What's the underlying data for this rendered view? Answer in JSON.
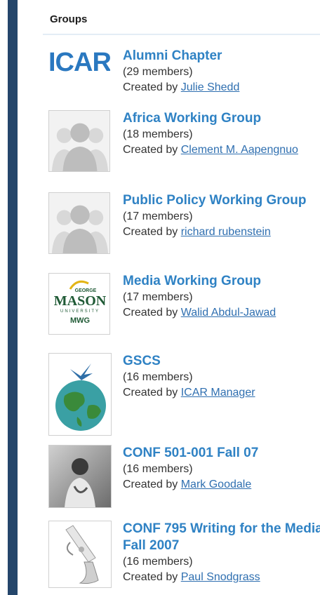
{
  "panel": {
    "title": "Groups"
  },
  "groups": [
    {
      "name": "Alumni Chapter",
      "members": "(29 members)",
      "created_prefix": "Created by ",
      "creator": "Julie Shedd",
      "thumb": "icar-logo"
    },
    {
      "name": "Africa Working Group",
      "members": "(18 members)",
      "created_prefix": "Created by ",
      "creator": "Clement M. Aapengnuo",
      "thumb": "default-people"
    },
    {
      "name": "Public Policy Working Group",
      "members": "(17 members)",
      "created_prefix": "Created by ",
      "creator": "richard rubenstein",
      "thumb": "default-people"
    },
    {
      "name": "Media Working Group",
      "members": "(17 members)",
      "created_prefix": "Created by ",
      "creator": "Walid Abdul-Jawad",
      "thumb": "mason-logo"
    },
    {
      "name": "GSCS",
      "members": "(16 members)",
      "created_prefix": "Created by ",
      "creator": "ICAR Manager",
      "thumb": "globe-image"
    },
    {
      "name": "CONF 501-001 Fall 07",
      "members": "(16 members)",
      "created_prefix": "Created by ",
      "creator": "Mark Goodale",
      "thumb": "photo-gandhi"
    },
    {
      "name": "CONF 795 Writing for the Media Fall 2007",
      "members": "(16 members)",
      "created_prefix": "Created by ",
      "creator": "Paul Snodgrass",
      "thumb": "award-image"
    }
  ],
  "logos": {
    "icar_text": "ICAR",
    "mason_top": "GEORGE",
    "mason_main": "MASON",
    "mason_sub": "UNIVERSITY",
    "mason_abbr": "MWG"
  },
  "colors": {
    "stripe": "#25466b",
    "group_link": "#2f82c4",
    "creator_link": "#2f6fb0"
  }
}
